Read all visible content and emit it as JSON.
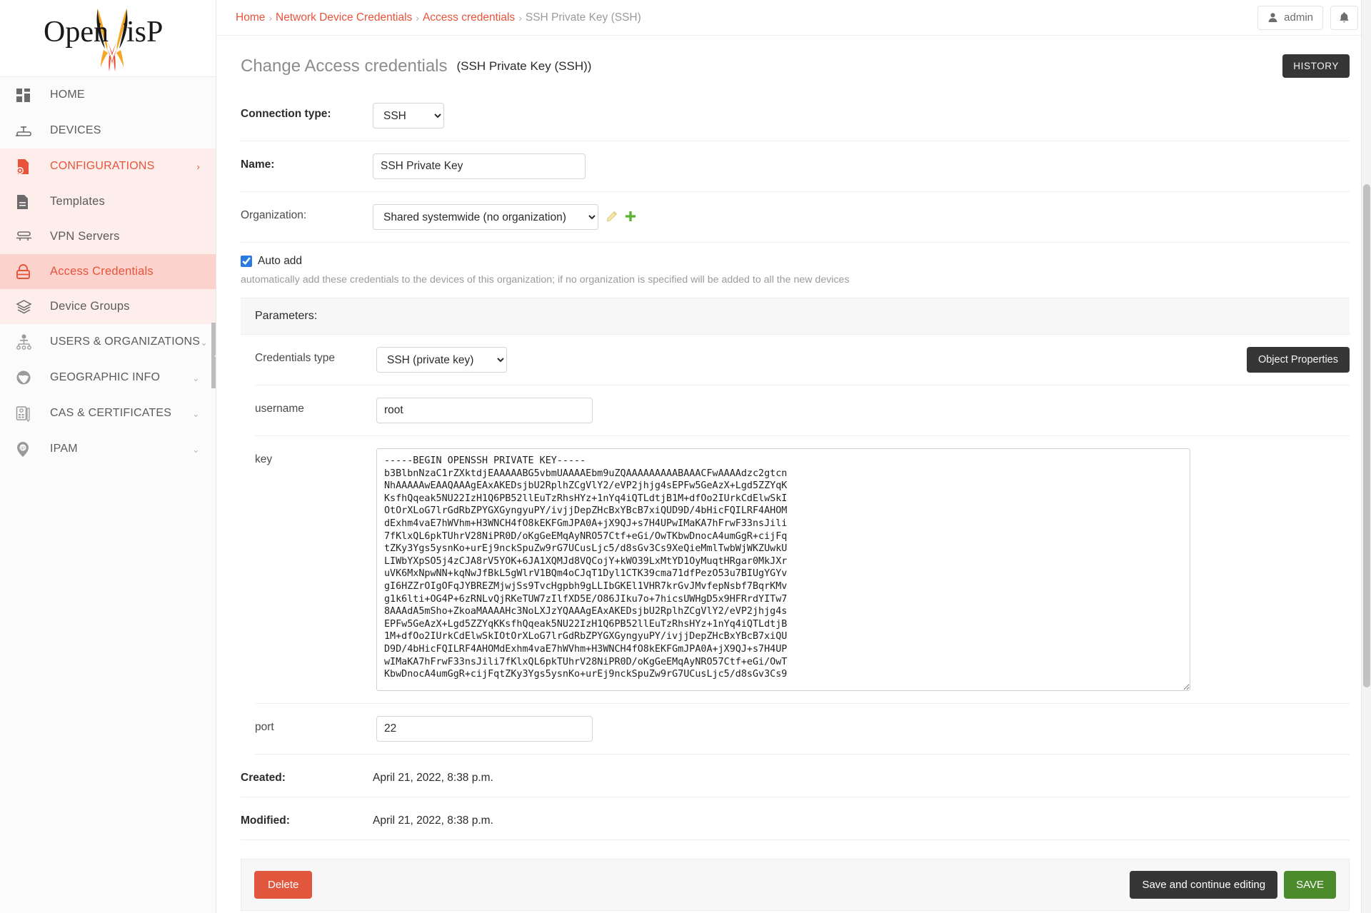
{
  "brand": {
    "logo_text": "OpenWISP"
  },
  "sidebar": {
    "items": [
      {
        "label": "HOME",
        "icon": "home-grid-icon",
        "type": "group",
        "state": "normal"
      },
      {
        "label": "DEVICES",
        "icon": "device-router-icon",
        "type": "group",
        "state": "normal"
      },
      {
        "label": "CONFIGURATIONS",
        "icon": "configurations-file-gear-icon",
        "type": "group",
        "state": "open",
        "chevron": "›"
      },
      {
        "label": "Templates",
        "icon": "template-document-icon",
        "type": "sub",
        "state": "normal"
      },
      {
        "label": "VPN Servers",
        "icon": "vpn-server-icon",
        "type": "sub",
        "state": "normal"
      },
      {
        "label": "Access Credentials",
        "icon": "access-credentials-lock-icon",
        "type": "sub",
        "state": "active"
      },
      {
        "label": "Device Groups",
        "icon": "device-groups-layers-icon",
        "type": "sub",
        "state": "normal"
      },
      {
        "label": "USERS & ORGANIZATIONS",
        "icon": "users-organizations-icon",
        "type": "group",
        "state": "collapsed",
        "chevron": "⌄"
      },
      {
        "label": "GEOGRAPHIC INFO",
        "icon": "globe-icon",
        "type": "group",
        "state": "collapsed",
        "chevron": "⌄"
      },
      {
        "label": "CAS & CERTIFICATES",
        "icon": "certificates-icon",
        "type": "group",
        "state": "collapsed",
        "chevron": "⌄"
      },
      {
        "label": "IPAM",
        "icon": "ipam-pin-icon",
        "type": "group",
        "state": "collapsed",
        "chevron": "⌄"
      }
    ],
    "collapse_handle_glyph": "❮"
  },
  "topbar": {
    "breadcrumb": [
      {
        "label": "Home",
        "link": true
      },
      {
        "label": "Network Device Credentials",
        "link": true
      },
      {
        "label": "Access credentials",
        "link": true
      },
      {
        "label": "SSH Private Key (SSH)",
        "link": false
      }
    ],
    "separator": "›",
    "user_button": "admin",
    "user_icon": "person-icon",
    "bell_icon": "bell-icon"
  },
  "page": {
    "title": "Change Access credentials",
    "subtitle": "(SSH Private Key (SSH))",
    "history_button": "HISTORY"
  },
  "form": {
    "connection_type": {
      "label": "Connection type:",
      "value": "SSH",
      "options": [
        "SSH"
      ]
    },
    "name": {
      "label": "Name:",
      "value": "SSH Private Key",
      "placeholder": ""
    },
    "organization": {
      "label": "Organization:",
      "value": "Shared systemwide (no organization)",
      "options": [
        "Shared systemwide (no organization)"
      ],
      "edit_icon": "pencil-edit-icon",
      "add_icon": "plus-add-icon"
    },
    "auto_add": {
      "label": "Auto add",
      "checked": true,
      "help": "automatically add these credentials to the devices of this organization; if no organization is specified will be added to all the new devices"
    }
  },
  "parameters": {
    "section_label": "Parameters:",
    "object_properties_button": "Object Properties",
    "credentials_type": {
      "label": "Credentials type",
      "value": "SSH (private key)",
      "options": [
        "SSH (private key)"
      ]
    },
    "username": {
      "label": "username",
      "value": "root"
    },
    "key": {
      "label": "key",
      "value": "-----BEGIN OPENSSH PRIVATE KEY-----\nb3BlbnNzaC1rZXktdjEAAAAABG5vbmUAAAAEbm9uZQAAAAAAAAABAAACFwAAAAdzc2gtcn\nNhAAAAAwEAAQAAAgEAxAKEDsjbU2RplhZCgVlY2/eVP2jhjg4sEPFw5GeAzX+Lgd5ZZYqK\nKsfhQqeak5NU22IzH1Q6PB52llEuTzRhsHYz+1nYq4iQTLdtjB1M+dfOo2IUrkCdElwSkI\nOtOrXLoG7lrGdRbZPYGXGyngyuPY/ivjjDepZHcBxYBcB7xiQUD9D/4bHicFQILRF4AHOM\ndExhm4vaE7hWVhm+H3WNCH4fO8kEKFGmJPA0A+jX9QJ+s7H4UPwIMaKA7hFrwF33nsJili\n7fKlxQL6pkTUhrV28NiPR0D/oKgGeEMqAyNRO57Ctf+eGi/OwTKbwDnocA4umGgR+cijFq\ntZKy3Ygs5ysnKo+urEj9nckSpuZw9rG7UCusLjc5/d8sGv3Cs9XeQieMmlTwbWjWKZUwkU\nLIWbYXpSO5j4zCJA8rV5YOK+6JA1XQMJd8VQCojY+kWO39LxMtYD1OyMuqtHRgar0MkJXr\nuVK6MxNpwNN+kqNwJfBkL5gWlrV1BQm4oCJqT1Dyl1CTK39cma71dfPezO53u7BIUgYGYv\ngI6HZZrOIgOFqJYBREZMjwjSs9TvcHgpbh9gLLIbGKEl1VHR7krGvJMvfepNsbf7BqrKMv\ng1k6lti+OG4P+6zRNLvQjRKeTUW7zIlfXD5E/O86JIku7o+7hicsUWHgD5x9HFRrdYITw7\n8AAAdA5mSho+ZkoaMAAAAHc3NoLXJzYQAAAgEAxAKEDsjbU2RplhZCgVlY2/eVP2jhjg4s\nEPFw5GeAzX+Lgd5ZZYqKKsfhQqeak5NU22IzH1Q6PB52llEuTzRhsHYz+1nYq4iQTLdtjB\n1M+dfOo2IUrkCdElwSkIOtOrXLoG7lrGdRbZPYGXGyngyuPY/ivjjDepZHcBxYBcB7xiQU\nD9D/4bHicFQILRF4AHOMdExhm4vaE7hWVhm+H3WNCH4fO8kEKFGmJPA0A+jX9QJ+s7H4UP\nwIMaKA7hFrwF33nsJili7fKlxQL6pkTUhrV28NiPR0D/oKgGeEMqAyNRO57Ctf+eGi/OwT\nKbwDnocA4umGgR+cijFqtZKy3Ygs5ysnKo+urEj9nckSpuZw9rG7UCusLjc5/d8sGv3Cs9"
    },
    "port": {
      "label": "port",
      "value": "22"
    }
  },
  "meta": {
    "created_label": "Created:",
    "created_value": "April 21, 2022, 8:38 p.m.",
    "modified_label": "Modified:",
    "modified_value": "April 21, 2022, 8:38 p.m."
  },
  "actions": {
    "delete": "Delete",
    "save_and_continue": "Save and continue editing",
    "save": "SAVE"
  },
  "colors": {
    "accent": "#e8543b",
    "accent_bg": "#fdeeec",
    "active_bg": "#fbd3cc",
    "dark_button": "#363636",
    "save_green": "#4b8b2b",
    "delete_red": "#e0573e",
    "checkbox_blue": "#2a7ae2"
  }
}
